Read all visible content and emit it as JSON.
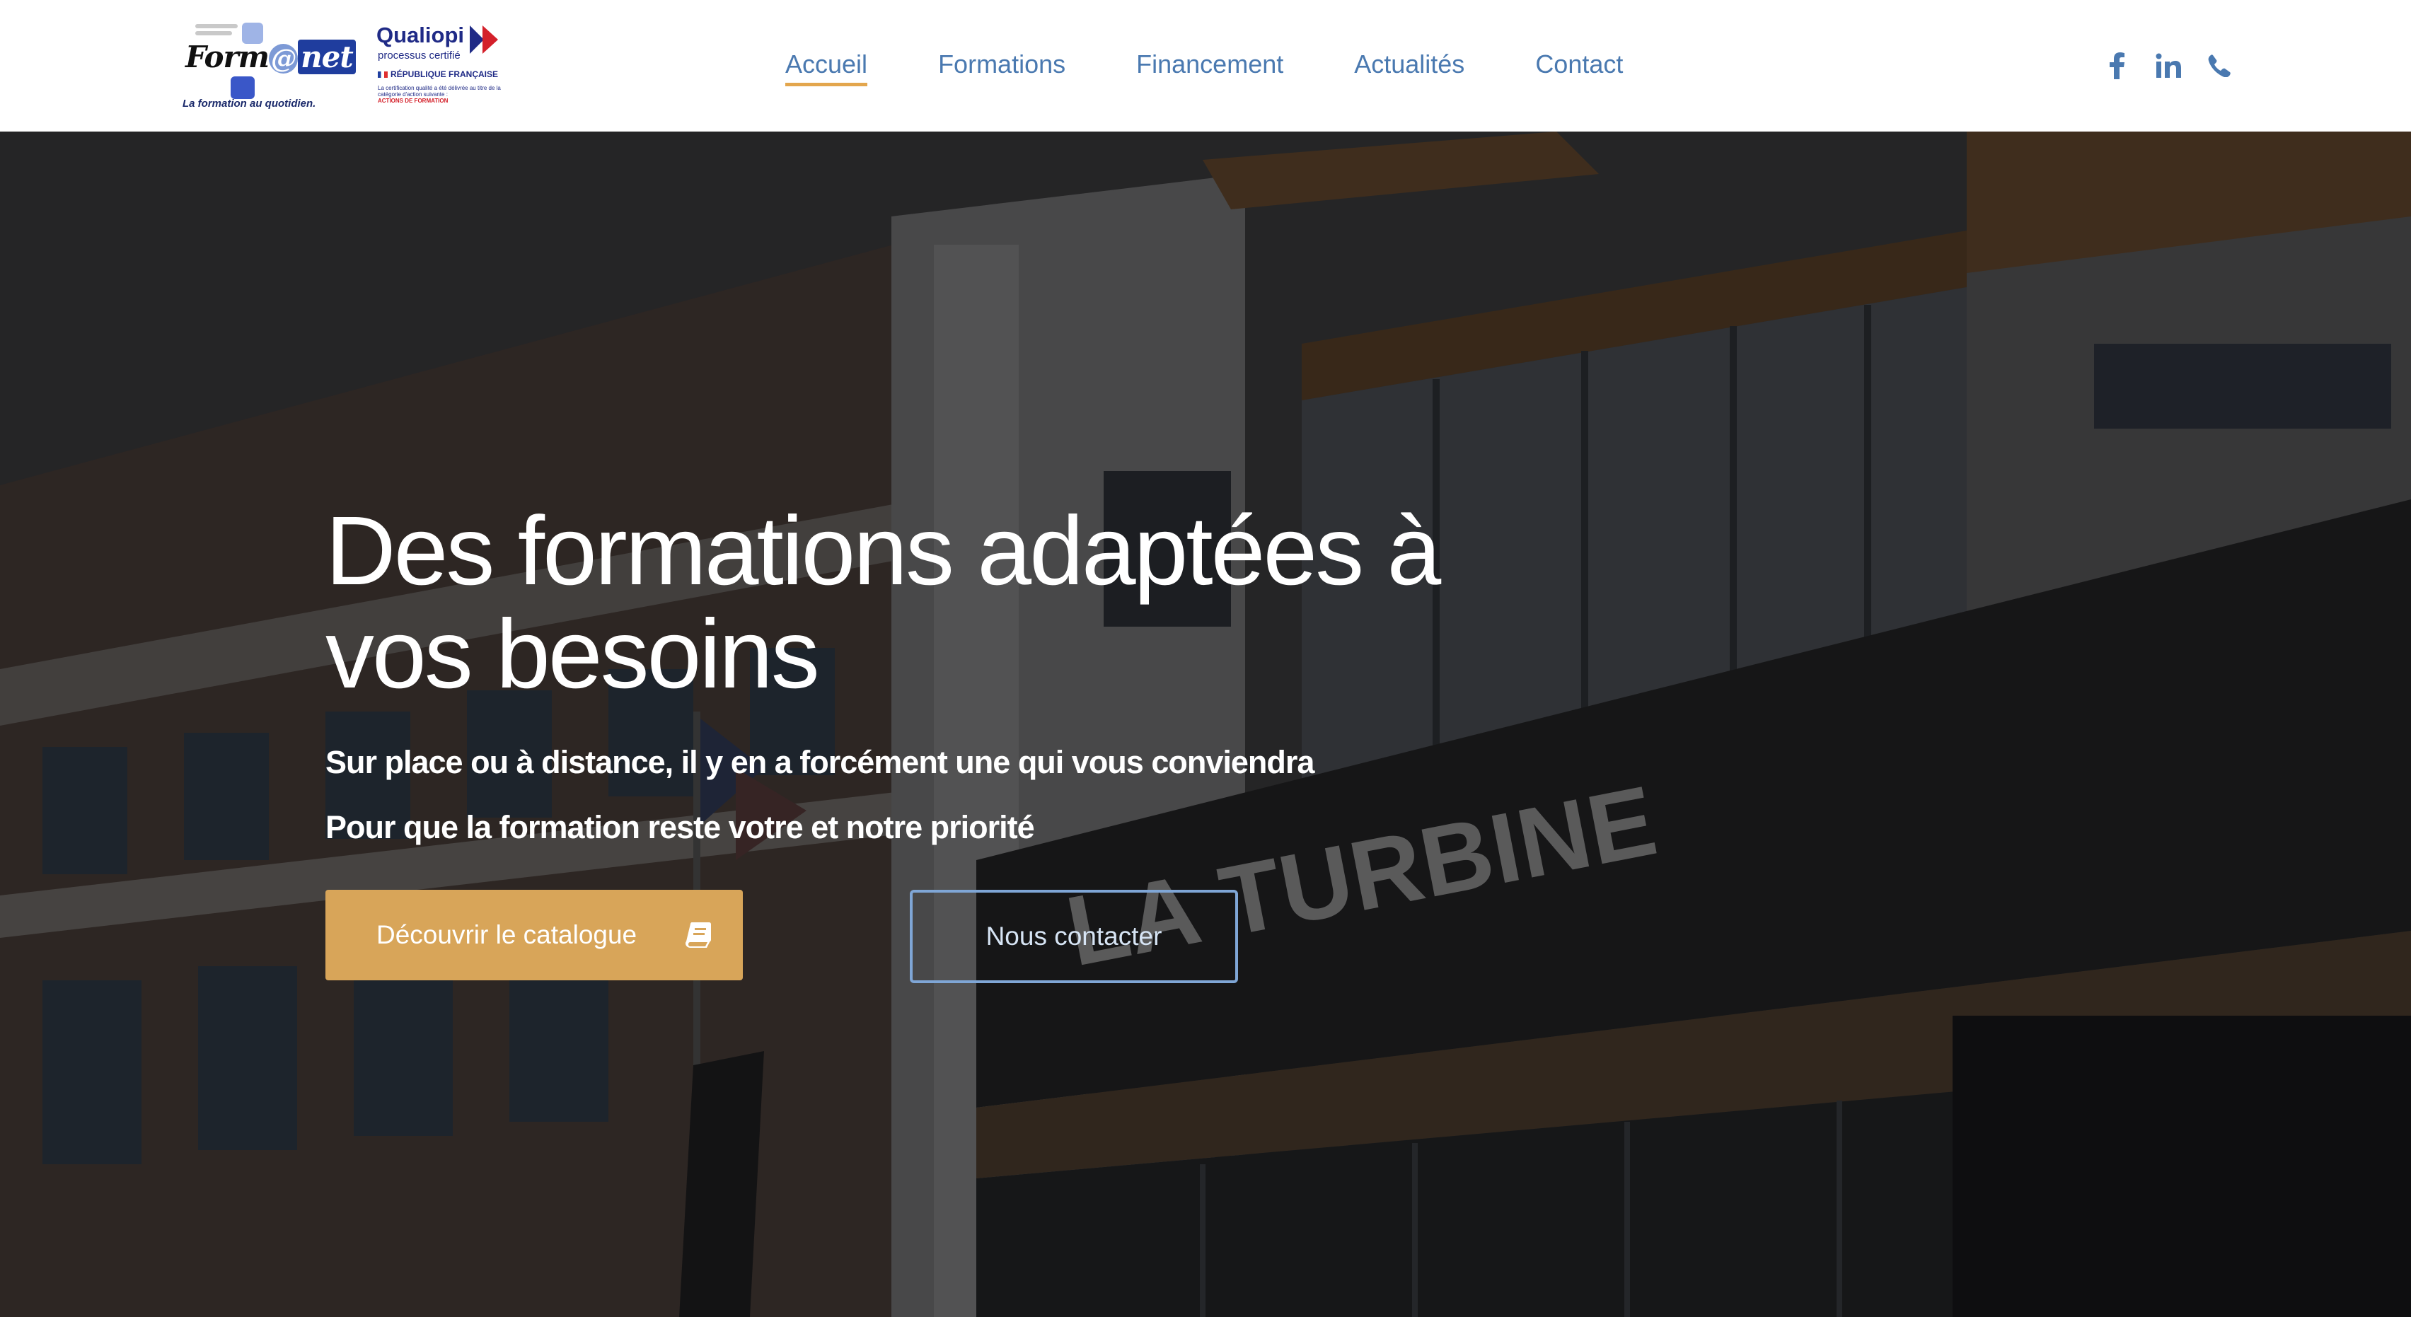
{
  "header": {
    "logo_formanet": {
      "word_form": "Form",
      "word_at": "@",
      "word_net": "net",
      "tagline": "La formation au quotidien."
    },
    "logo_qualiopi": {
      "title": "Qualiopi",
      "subtitle": "processus certifié",
      "republique": "RÉPUBLIQUE FRANÇAISE",
      "small_text": "La certification qualité a été délivrée au titre de la catégorie d'action suivante :",
      "small_red": "ACTIONS DE FORMATION"
    },
    "nav": [
      {
        "label": "Accueil",
        "active": true
      },
      {
        "label": "Formations",
        "active": false
      },
      {
        "label": "Financement",
        "active": false
      },
      {
        "label": "Actualités",
        "active": false
      },
      {
        "label": "Contact",
        "active": false
      }
    ],
    "socials": [
      "facebook-icon",
      "linkedin-icon",
      "phone-icon"
    ]
  },
  "hero": {
    "title": "Des formations adaptées à vos besoins",
    "subtitle_1": "Sur place ou à distance, il y en a forcément une qui vous conviendra",
    "subtitle_2": "Pour que la formation reste votre et notre priorité",
    "cta_primary": "Découvrir le catalogue",
    "cta_secondary": "Nous contacter",
    "building_sign": "LA TURBINE"
  },
  "colors": {
    "nav_text": "#4a79b0",
    "nav_active_underline": "#e3a64d",
    "cta_primary_bg": "#d8a559",
    "cta_secondary_border": "#7fa6d6"
  }
}
